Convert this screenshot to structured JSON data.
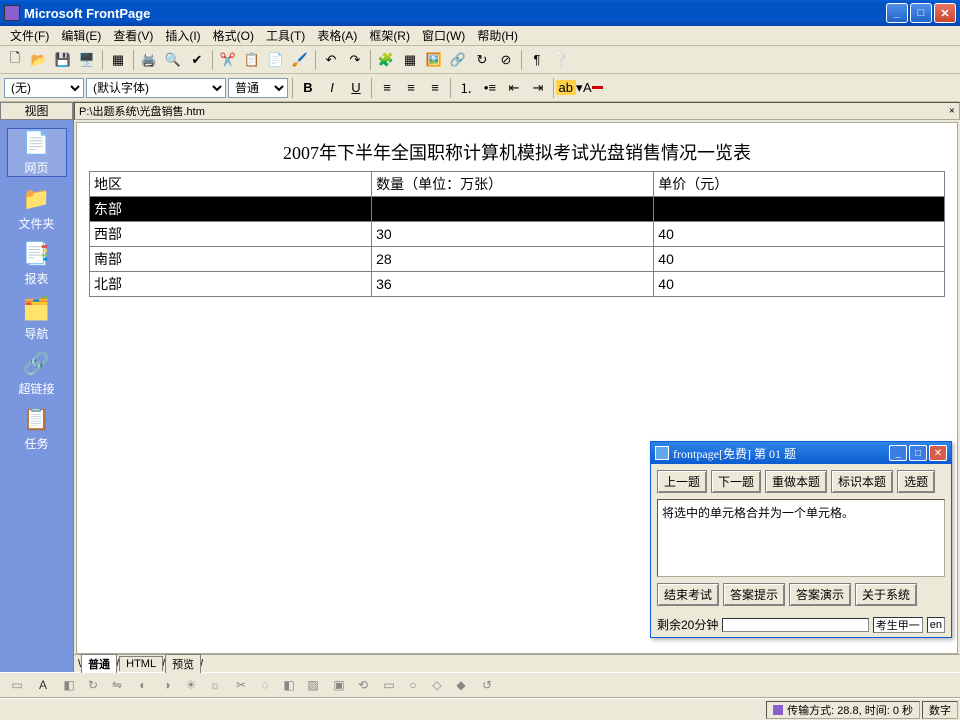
{
  "app": {
    "title": "Microsoft FrontPage"
  },
  "menubar": [
    "文件(F)",
    "编辑(E)",
    "查看(V)",
    "插入(I)",
    "格式(O)",
    "工具(T)",
    "表格(A)",
    "框架(R)",
    "窗口(W)",
    "帮助(H)"
  ],
  "format_toolbar": {
    "style_value": "(无)",
    "font_value": "(默认字体)",
    "size_value": "普通"
  },
  "sidebar": {
    "header": "视图",
    "items": [
      {
        "label": "网页",
        "icon": "📄"
      },
      {
        "label": "文件夹",
        "icon": "📁"
      },
      {
        "label": "报表",
        "icon": "📑"
      },
      {
        "label": "导航",
        "icon": "🗂️"
      },
      {
        "label": "超链接",
        "icon": "🔗"
      },
      {
        "label": "任务",
        "icon": "📋"
      }
    ]
  },
  "document": {
    "path": "P:\\出题系统\\光盘销售.htm",
    "page_title": "2007年下半年全国职称计算机模拟考试光盘销售情况一览表",
    "columns": [
      "地区",
      "数量（单位：万张）",
      "单价（元）"
    ],
    "rows": [
      {
        "cells": [
          "东部",
          "",
          ""
        ],
        "selected": true
      },
      {
        "cells": [
          "西部",
          "30",
          "40"
        ],
        "selected": false
      },
      {
        "cells": [
          "南部",
          "28",
          "40"
        ],
        "selected": false
      },
      {
        "cells": [
          "北部",
          "36",
          "40"
        ],
        "selected": false
      }
    ]
  },
  "viewtabs": [
    "普通",
    "HTML",
    "预览"
  ],
  "status": {
    "transfer": "传输方式: 28.8, 时间: 0 秒",
    "mode": "数字"
  },
  "exam": {
    "title": "frontpage[免费] 第 01 题",
    "row1": [
      "上一题",
      "下一题",
      "重做本题",
      "标识本题",
      "选题"
    ],
    "question": "将选中的单元格合并为一个单元格。",
    "row2": [
      "结束考试",
      "答案提示",
      "答案演示",
      "关于系统"
    ],
    "remaining": "剩余20分钟",
    "student": "考生甲一",
    "lang": "en"
  }
}
